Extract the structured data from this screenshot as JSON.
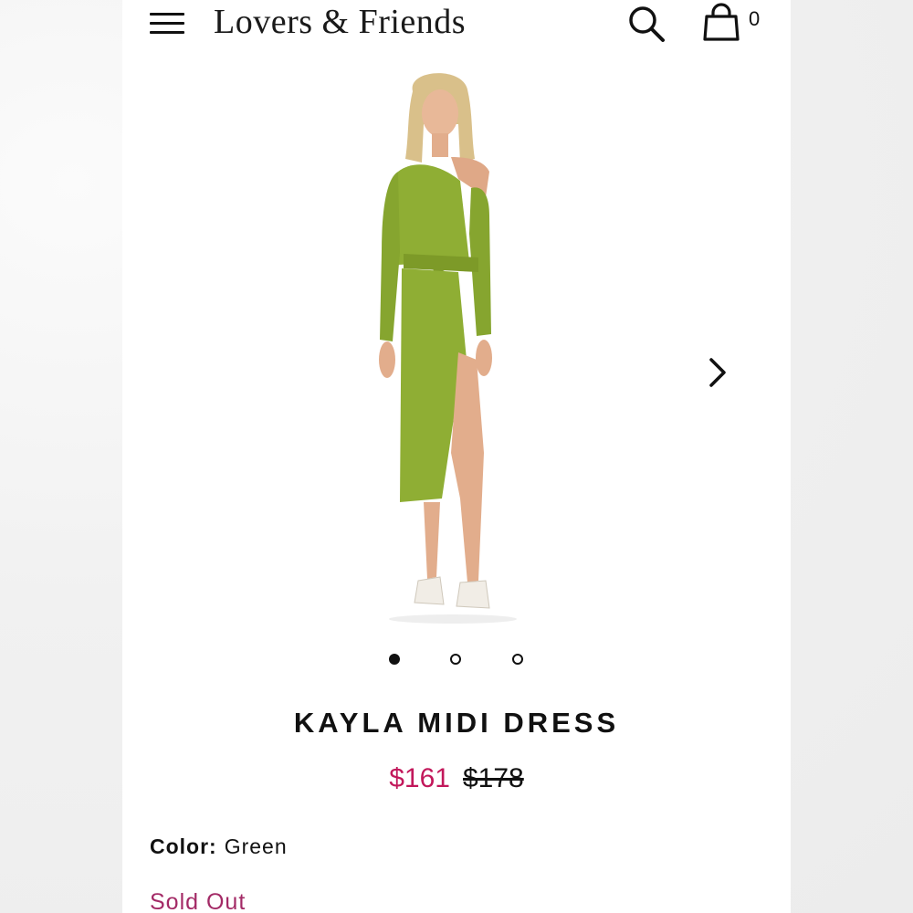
{
  "header": {
    "brand": "Lovers & Friends",
    "cart_count": "0",
    "icons": {
      "menu": "hamburger-menu-icon",
      "search": "search-icon",
      "cart": "shopping-bag-icon"
    }
  },
  "product": {
    "name": "KAYLA MIDI DRESS",
    "sale_price": "$161",
    "original_price": "$178",
    "color_label": "Color:",
    "color_value": "Green",
    "availability": "Sold Out",
    "image_count": 3,
    "active_image_index": 0
  },
  "colors": {
    "dress": "#8fae34",
    "sale_price": "#c2185b",
    "sold_out": "#a32a66",
    "text": "#111111"
  }
}
